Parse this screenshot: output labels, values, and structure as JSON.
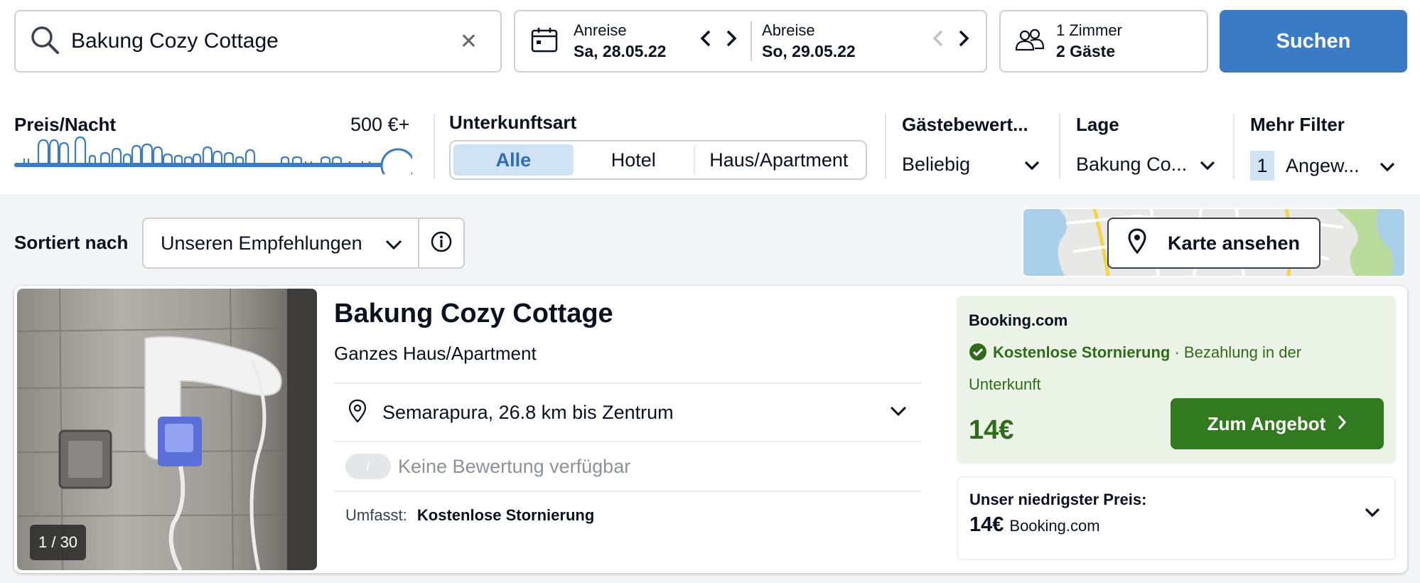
{
  "search": {
    "query": "Bakung Cozy Cottage",
    "clear": "✕"
  },
  "dates": {
    "checkin_label": "Anreise",
    "checkin_value": "Sa, 28.05.22",
    "checkout_label": "Abreise",
    "checkout_value": "So, 29.05.22"
  },
  "guests": {
    "rooms": "1 Zimmer",
    "guests": "2 Gäste"
  },
  "search_button": "Suchen",
  "filters": {
    "price": {
      "label": "Preis/Nacht",
      "max_label": "500 €+",
      "slider_fraction": 1.0
    },
    "accommodation": {
      "label": "Unterkunftsart",
      "options": [
        "Alle",
        "Hotel",
        "Haus/Apartment"
      ],
      "selected": "Alle"
    },
    "rating": {
      "label": "Gästebewert...",
      "value": "Beliebig"
    },
    "location": {
      "label": "Lage",
      "value": "Bakung Co..."
    },
    "more": {
      "label": "Mehr Filter",
      "count": "1",
      "value": "Angew..."
    }
  },
  "sort": {
    "label": "Sortiert nach",
    "value": "Unseren Empfehlungen"
  },
  "map_button": "Karte ansehen",
  "result": {
    "photo_counter": "1 / 30",
    "title": "Bakung Cozy Cottage",
    "type": "Ganzes Haus/Apartment",
    "location": "Semarapura, 26.8 km bis Zentrum",
    "rating_pill": "/",
    "rating_text": "Keine Bewertung verfügbar",
    "includes_label": "Umfasst:",
    "includes_value": "Kostenlose Stornierung",
    "deal": {
      "provider": "Booking.com",
      "cancellation": "Kostenlose Stornierung",
      "payment": "· Bezahlung in der Unterkunft",
      "price": "14€",
      "button": "Zum Angebot"
    },
    "lowest": {
      "label": "Unser niedrigster Preis:",
      "price": "14€",
      "provider": "Booking.com"
    }
  },
  "colors": {
    "primary": "#3b7bc6",
    "deal_green": "#317a1f",
    "deal_bg": "#ebf3e6"
  }
}
